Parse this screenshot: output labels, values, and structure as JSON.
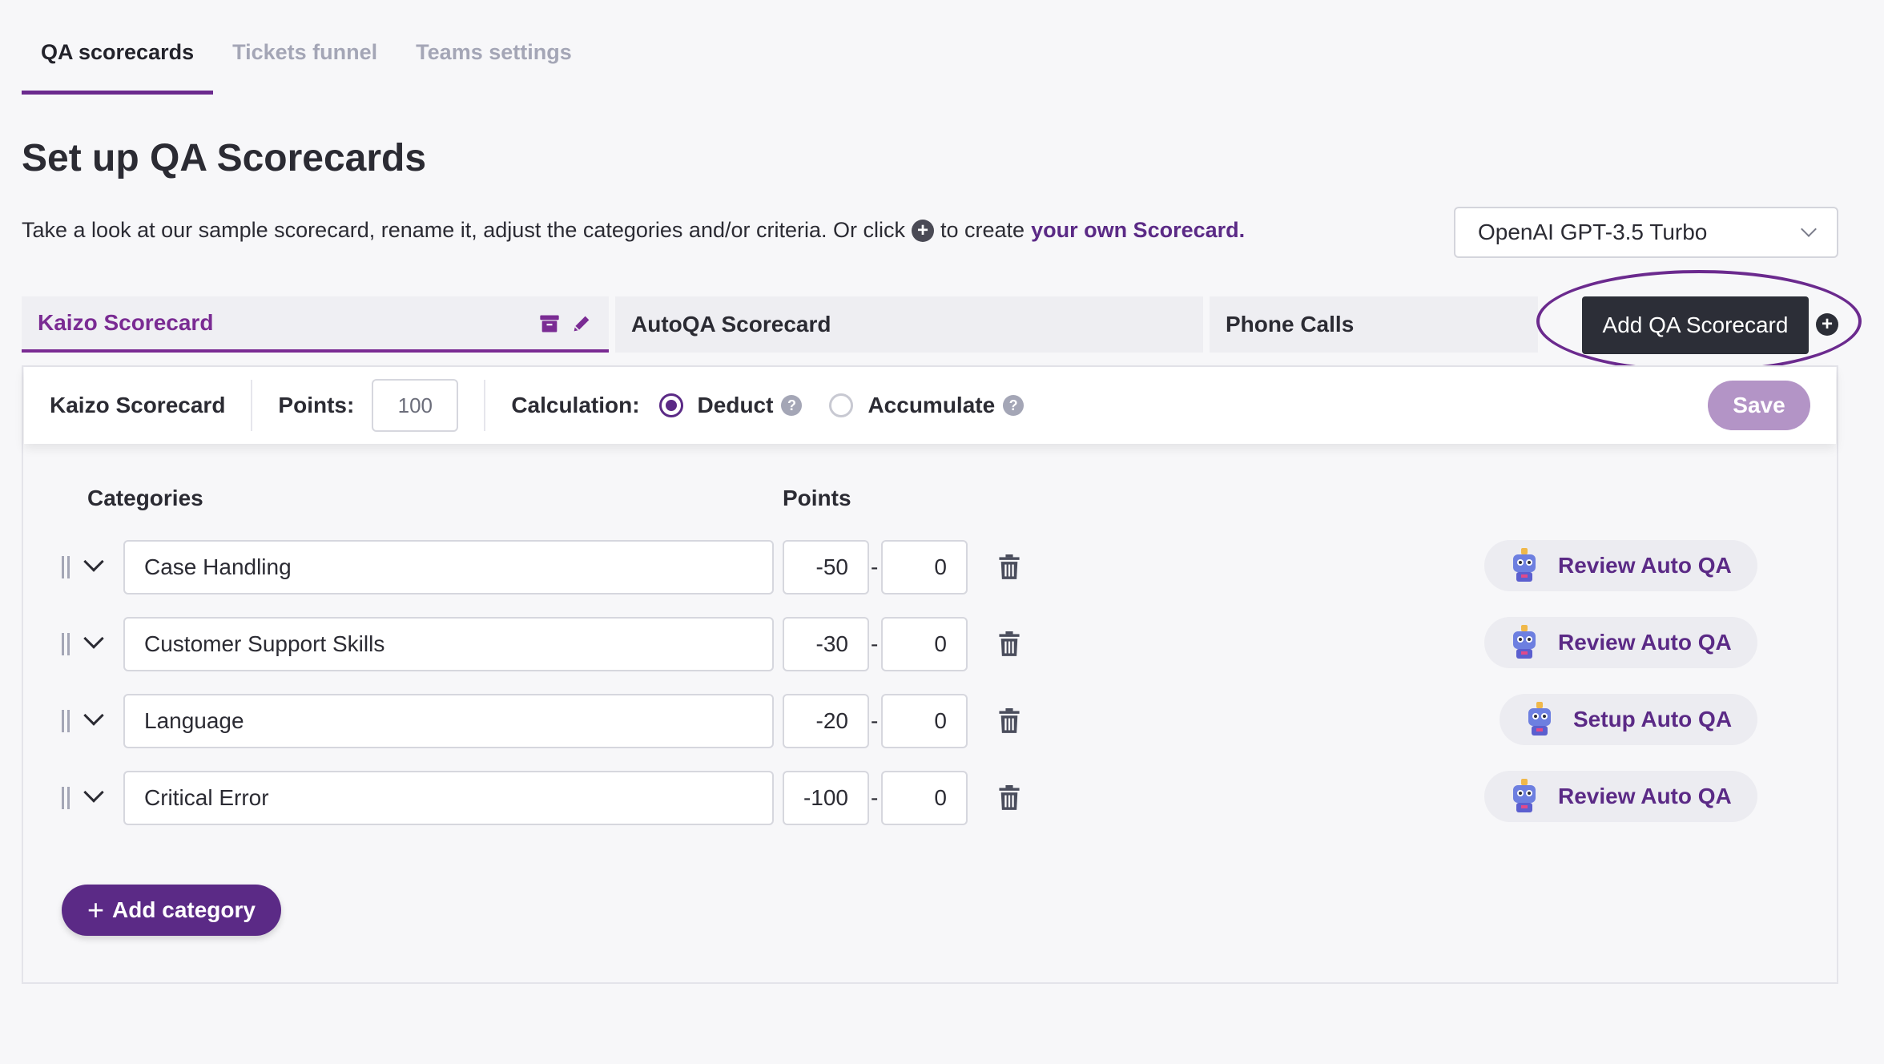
{
  "tabs": [
    {
      "label": "QA scorecards",
      "active": true
    },
    {
      "label": "Tickets funnel",
      "active": false
    },
    {
      "label": "Teams settings",
      "active": false
    }
  ],
  "page_title": "Set up QA Scorecards",
  "intro": {
    "text_before": "Take a look at our sample scorecard, rename it, adjust the categories and/or criteria. Or click",
    "text_middle": "to create",
    "link": "your own Scorecard."
  },
  "model_select": {
    "value": "OpenAI GPT-3.5 Turbo"
  },
  "scorecard_tabs": [
    {
      "label": "Kaizo Scorecard",
      "active": true
    },
    {
      "label": "AutoQA Scorecard",
      "active": false
    },
    {
      "label": "Phone Calls",
      "active": false
    }
  ],
  "add_scorecard_label": "Add QA Scorecard",
  "settings": {
    "name": "Kaizo Scorecard",
    "points_label": "Points:",
    "points_value": "100",
    "calculation_label": "Calculation:",
    "option_deduct": "Deduct",
    "option_accumulate": "Accumulate",
    "selected": "Deduct",
    "save_label": "Save"
  },
  "columns": {
    "categories": "Categories",
    "points": "Points"
  },
  "categories": [
    {
      "name": "Case Handling",
      "min": "-50",
      "max": "0",
      "action": "Review Auto QA"
    },
    {
      "name": "Customer Support Skills",
      "min": "-30",
      "max": "0",
      "action": "Review Auto QA"
    },
    {
      "name": "Language",
      "min": "-20",
      "max": "0",
      "action": "Setup Auto QA"
    },
    {
      "name": "Critical Error",
      "min": "-100",
      "max": "0",
      "action": "Review Auto QA"
    }
  ],
  "add_category_label": "Add category",
  "colors": {
    "accent": "#5b2a86",
    "highlight": "#6b2a8e",
    "dark_button": "#2c2e37",
    "save_disabled": "#b394c6"
  }
}
